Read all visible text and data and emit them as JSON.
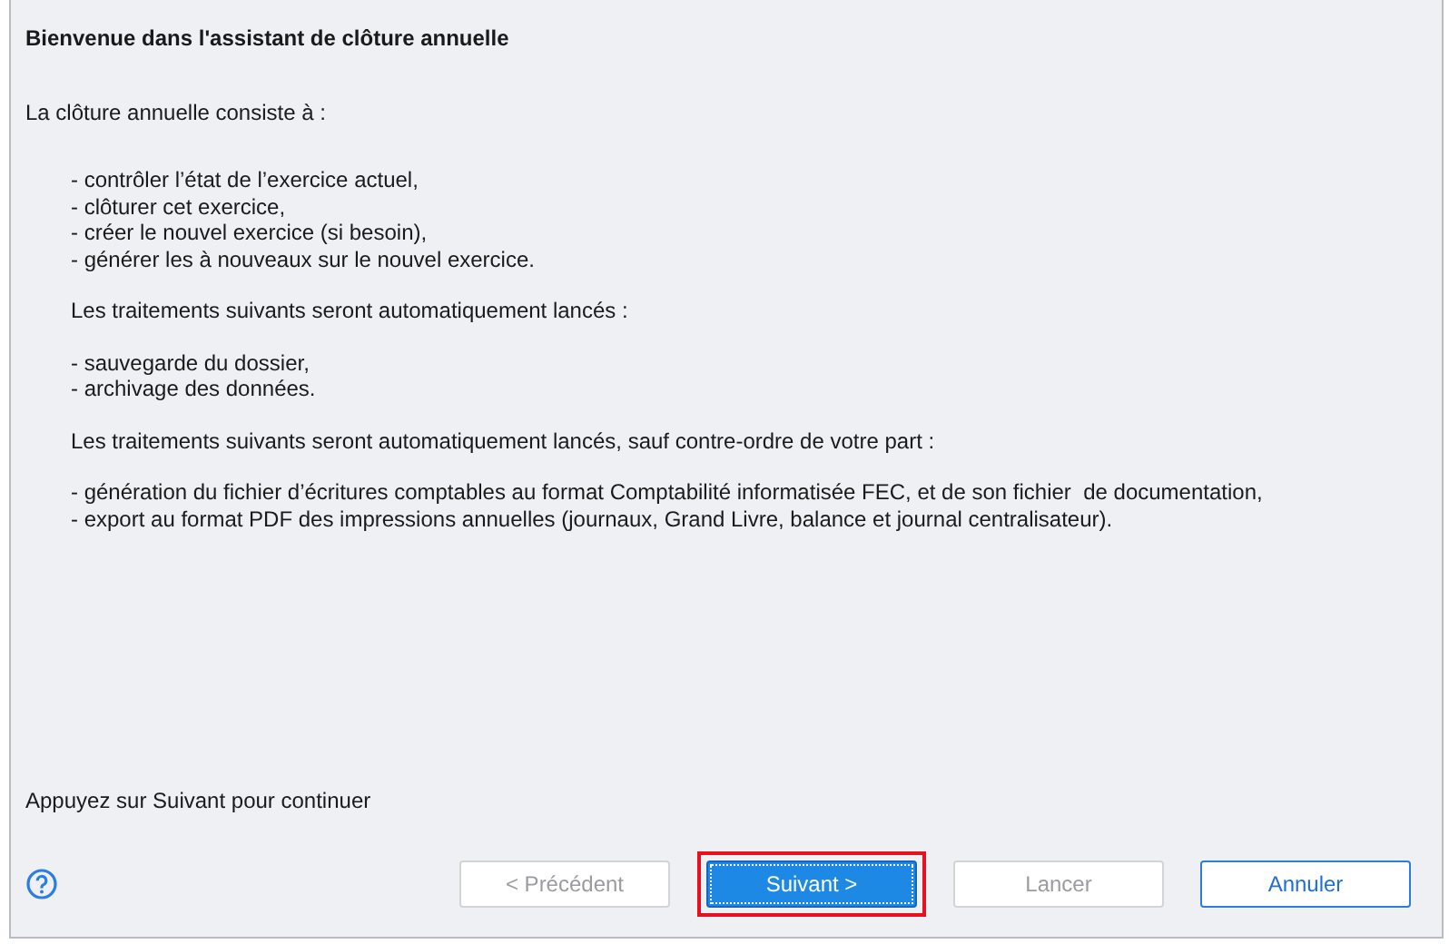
{
  "title": "Bienvenue dans l'assistant de clôture annuelle",
  "blocks": [
    {
      "kind": "lead",
      "text": "La clôture annuelle consiste à :"
    },
    {
      "kind": "list",
      "items": [
        "- contrôler l’état de l’exercice actuel,",
        "- clôturer cet exercice,",
        "- créer le nouvel exercice (si besoin),",
        "- générer les à nouveaux sur le nouvel exercice."
      ]
    },
    {
      "kind": "note",
      "text": "Les traitements suivants seront automatiquement lancés :"
    },
    {
      "kind": "list",
      "items": [
        "- sauvegarde du dossier,",
        "- archivage des données."
      ]
    },
    {
      "kind": "note",
      "text": "Les traitements suivants seront automatiquement lancés, sauf contre-ordre de votre part :"
    },
    {
      "kind": "list",
      "items": [
        "- génération du fichier d’écritures comptables au format Comptabilité informatisée FEC, et de son fichier  de documentation,",
        "- export au format PDF des impressions annuelles (journaux, Grand Livre, balance et journal centralisateur)."
      ]
    }
  ],
  "hint": "Appuyez sur Suivant pour continuer",
  "buttons": [
    {
      "label": "< Précédent",
      "kind": "normal",
      "disabled": true,
      "highlighted": false
    },
    {
      "label": "Suivant >",
      "kind": "primary",
      "disabled": false,
      "highlighted": true
    },
    {
      "label": "Lancer",
      "kind": "normal",
      "disabled": true,
      "highlighted": false
    },
    {
      "label": "Annuler",
      "kind": "default",
      "disabled": false,
      "highlighted": false
    }
  ]
}
